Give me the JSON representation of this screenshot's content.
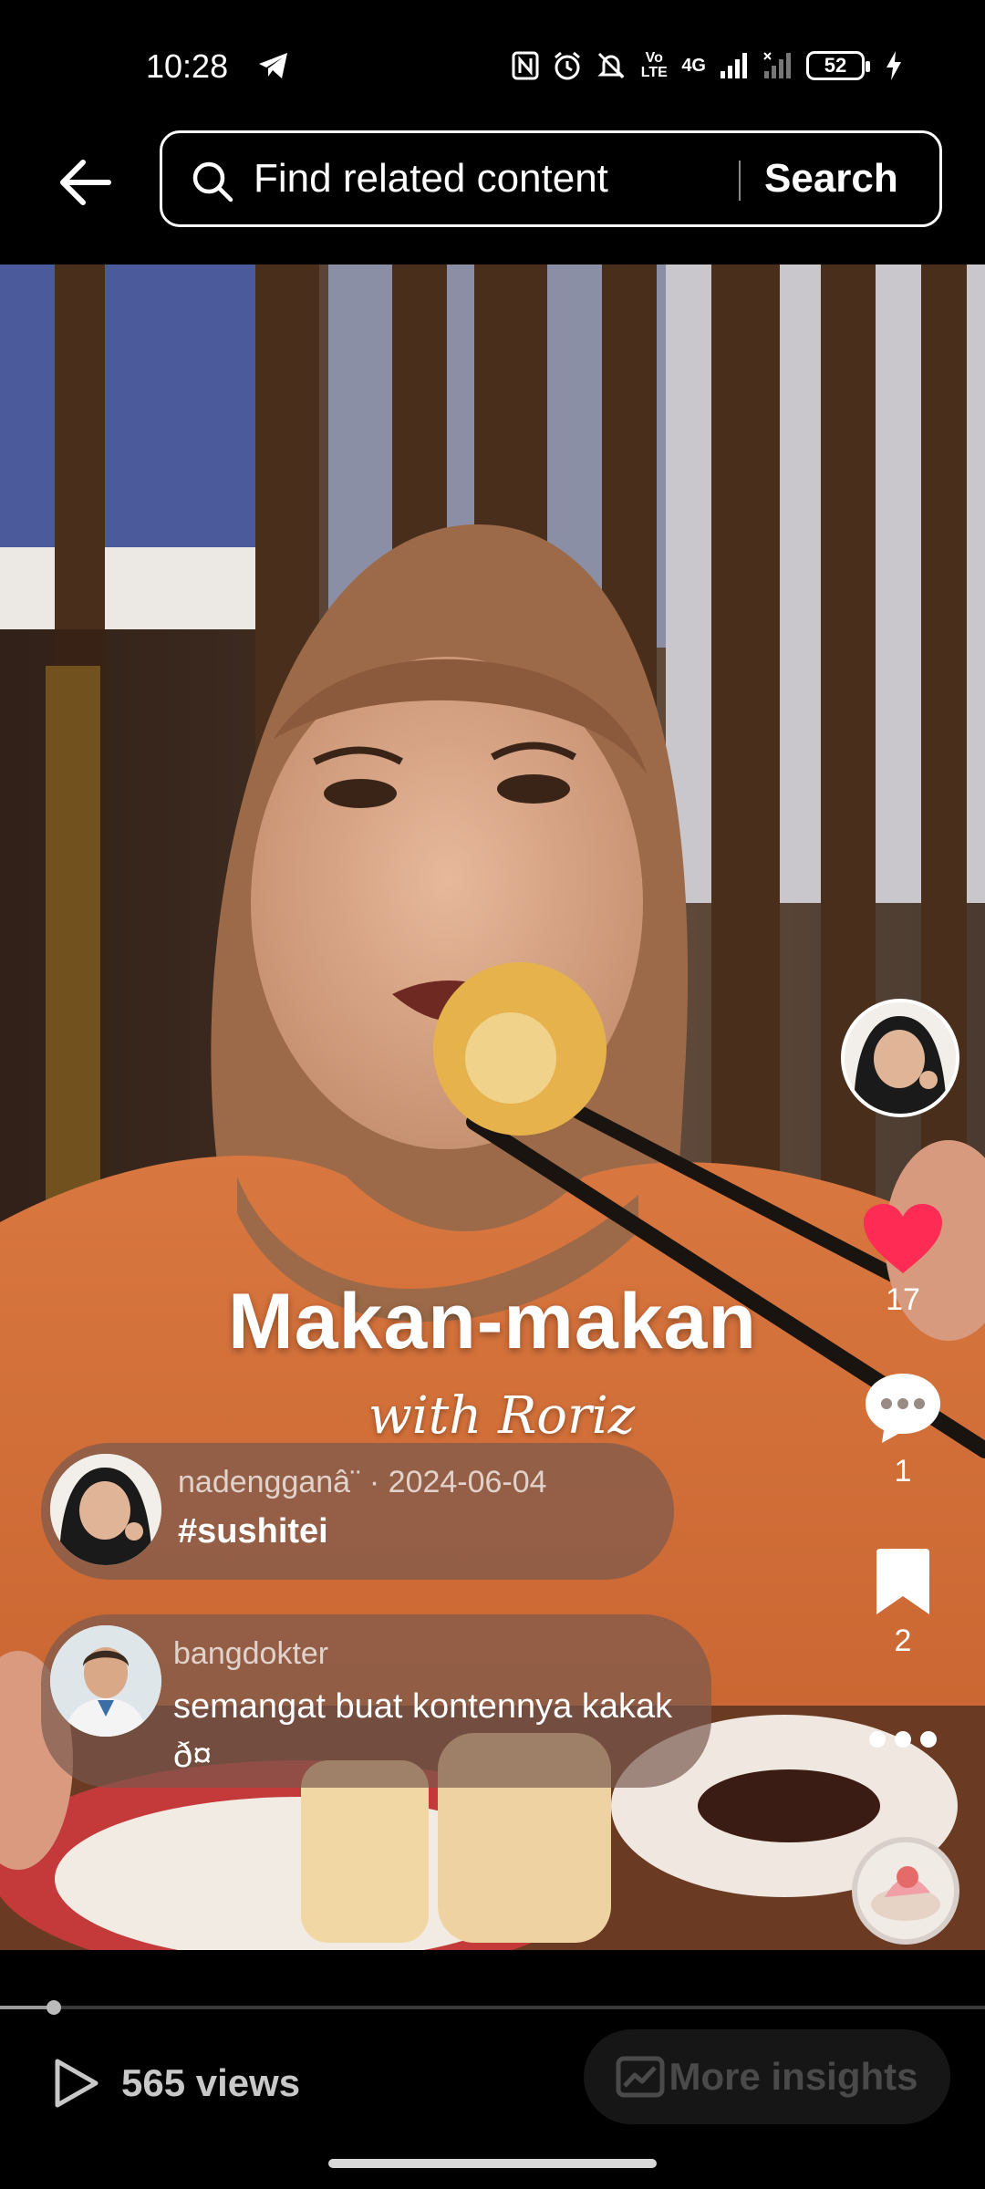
{
  "status_bar": {
    "time": "10:28",
    "battery": "52",
    "network_label": "4G",
    "volte_label": "Vo LTE",
    "icons": [
      "telegram-icon",
      "nfc-icon",
      "alarm-icon",
      "mute-icon",
      "volte-icon",
      "signal-icon",
      "signal-2-icon",
      "battery-icon",
      "charging-icon"
    ]
  },
  "header": {
    "search_placeholder": "Find related content",
    "search_button": "Search"
  },
  "video": {
    "overlay_title": "Makan-makan",
    "overlay_subtitle": "with Roriz"
  },
  "actions": {
    "likes": "17",
    "comments": "1",
    "saves": "2",
    "like_color": "#fe2c55"
  },
  "comments": [
    {
      "username": "nadengganâ¨",
      "date": "2024-06-04",
      "separator": "·",
      "text": "#sushitei"
    },
    {
      "username": "bangdokter",
      "text": "semangat buat kontennya kakak ð¤­"
    }
  ],
  "footer": {
    "views": "565 views",
    "insights_label": "More insights",
    "progress_fraction": 0.055
  }
}
